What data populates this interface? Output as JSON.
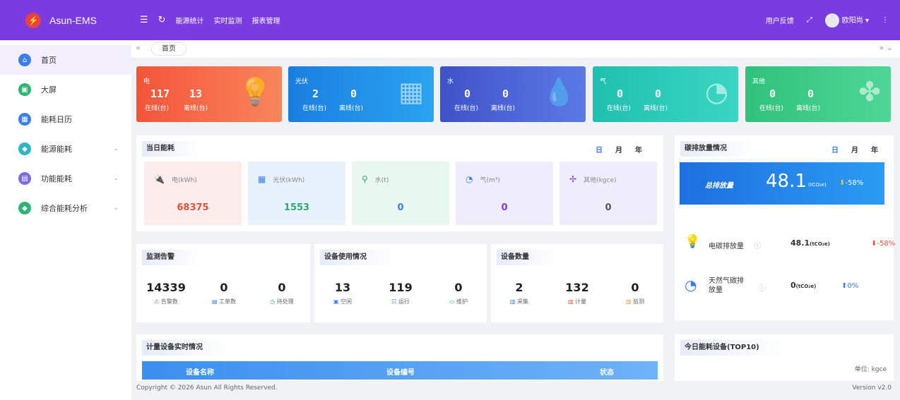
{
  "app": {
    "title": "Asun-EMS"
  },
  "topnav": {
    "items": [
      "能源统计",
      "实时监测",
      "报表管理"
    ]
  },
  "topright": {
    "feedback": "用户反馈",
    "username": "欧阳尚"
  },
  "sidebar": {
    "items": [
      {
        "label": "首页",
        "color": "#3b7ee8"
      },
      {
        "label": "大屏",
        "color": "#2bb673"
      },
      {
        "label": "能耗日历",
        "color": "#3b7ee8"
      },
      {
        "label": "能源能耗",
        "color": "#2bb6c8"
      },
      {
        "label": "功能能耗",
        "color": "#7a6be0"
      },
      {
        "label": "综合能耗分析",
        "color": "#2bb673"
      }
    ]
  },
  "tabbar": {
    "active_tab": "首页"
  },
  "cards": [
    {
      "label": "电",
      "online": "117",
      "offline": "13",
      "online_label": "在线(台)",
      "offline_label": "离线(台)",
      "color": "#f46a3e"
    },
    {
      "label": "光伏",
      "online": "2",
      "offline": "0",
      "online_label": "在线(台)",
      "offline_label": "离线(台)",
      "color": "#1f8be6"
    },
    {
      "label": "水",
      "online": "0",
      "offline": "0",
      "online_label": "在线(台)",
      "offline_label": "离线(台)",
      "color": "#4a63d6"
    },
    {
      "label": "气",
      "online": "0",
      "offline": "0",
      "online_label": "在线(台)",
      "offline_label": "离线(台)",
      "color": "#27c4b5"
    },
    {
      "label": "其他",
      "online": "0",
      "offline": "0",
      "online_label": "在线(台)",
      "offline_label": "离线(台)",
      "color": "#3fc987"
    }
  ],
  "daily": {
    "title": "当日能耗",
    "tabs": [
      "日",
      "月",
      "年"
    ],
    "items": [
      {
        "name": "电(kWh)",
        "value": "68375",
        "bg": "#fdebeb",
        "valcolor": "#e8503c"
      },
      {
        "name": "光伏(kWh)",
        "value": "1553",
        "bg": "#e8f2fd",
        "valcolor": "#2bab6a"
      },
      {
        "name": "水(t)",
        "value": "0",
        "bg": "#e8f8ef",
        "valcolor": "#3b7ee8"
      },
      {
        "name": "气(m³)",
        "value": "0",
        "bg": "#efedfb",
        "valcolor": "#7a3be0"
      },
      {
        "name": "其他(kgce)",
        "value": "0",
        "bg": "#efedfb",
        "valcolor": "#555"
      }
    ]
  },
  "carbon": {
    "title": "碳排放量情况",
    "tabs": [
      "日",
      "月",
      "年"
    ],
    "total_label": "总排放量",
    "total_value": "48.1",
    "total_unit": "(tCO₂e)",
    "total_change": "-58%",
    "rows": [
      {
        "name": "电碳排放量",
        "value": "48.1",
        "unit": "(tCO₂e)",
        "change": "-58%",
        "dir": "down"
      },
      {
        "name": "天然气碳排放量",
        "value": "0",
        "unit": "(tCO₂e)",
        "change": "0%",
        "dir": "up"
      }
    ]
  },
  "alarm": {
    "title": "监测告警",
    "stats": [
      {
        "value": "14339",
        "label": "告警数"
      },
      {
        "value": "0",
        "label": "工单数"
      },
      {
        "value": "0",
        "label": "待处理"
      }
    ]
  },
  "usage": {
    "title": "设备使用情况",
    "stats": [
      {
        "value": "13",
        "label": "空闲"
      },
      {
        "value": "119",
        "label": "运行"
      },
      {
        "value": "0",
        "label": "维护"
      }
    ]
  },
  "count": {
    "title": "设备数量",
    "stats": [
      {
        "value": "2",
        "label": "采集"
      },
      {
        "value": "132",
        "label": "计量"
      },
      {
        "value": "0",
        "label": "监测"
      }
    ]
  },
  "realtime": {
    "title": "计量设备实时情况",
    "columns": [
      "设备名称",
      "设备编号",
      "状态"
    ]
  },
  "top10": {
    "title": "今日能耗设备(TOP10)",
    "unit": "单位: kgce"
  },
  "footer": {
    "copyright": "Copyright © 2026 Asun All Rights Reserved.",
    "version": "Version v2.0"
  }
}
